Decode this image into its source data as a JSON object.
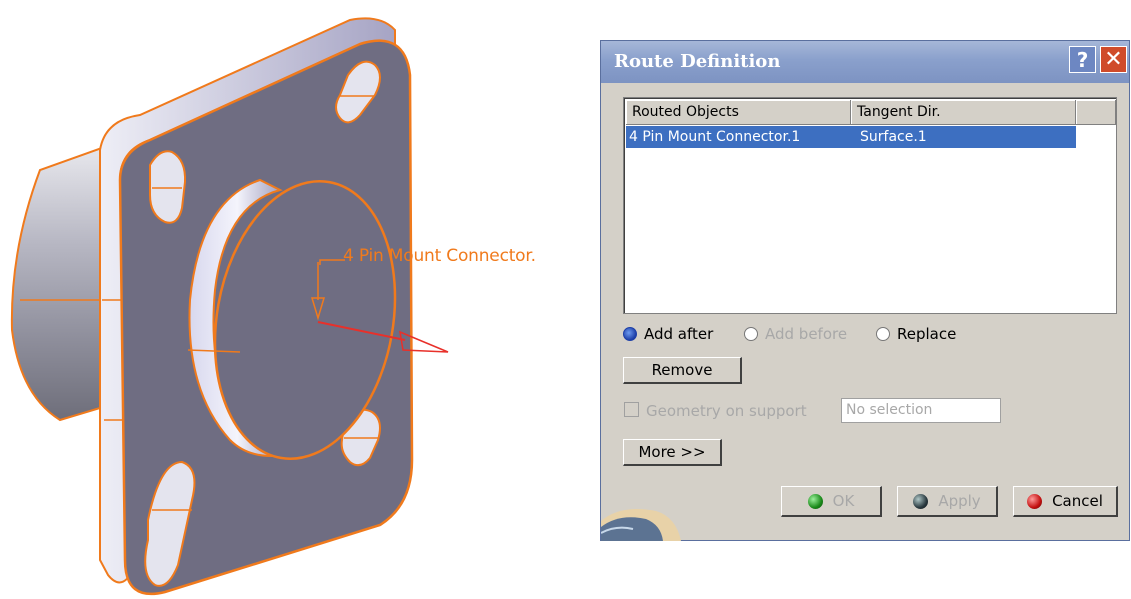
{
  "viewport": {
    "annotation_label": "4 Pin Mount Connector."
  },
  "dialog": {
    "title": "Route Definition",
    "help_glyph": "?",
    "close_glyph": "✕",
    "table": {
      "columns": [
        "Routed Objects",
        "Tangent Dir."
      ],
      "rows": [
        {
          "routed_object": "4 Pin Mount Connector.1",
          "tangent_dir": "Surface.1",
          "selected": true
        }
      ]
    },
    "mode": {
      "options": [
        "Add after",
        "Add before",
        "Replace"
      ],
      "selected": "Add after"
    },
    "remove_label": "Remove",
    "geometry_on_support": {
      "label": "Geometry on support",
      "checked": false,
      "value": "No selection"
    },
    "more_label": "More >>",
    "ok_label": "OK",
    "apply_label": "Apply",
    "cancel_label": "Cancel"
  },
  "colors": {
    "titlebar": "#8aa0cc",
    "selection": "#3d6fc1",
    "edge_highlight": "#f07a1c",
    "part_face": "#6f6d82"
  }
}
